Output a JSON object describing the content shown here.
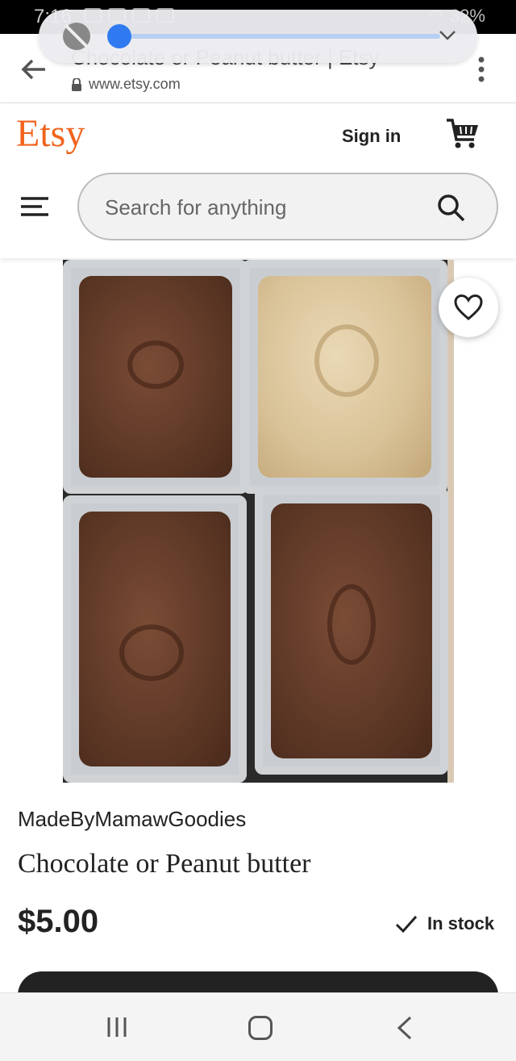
{
  "status_bar": {
    "time": "7:16",
    "battery": "32%"
  },
  "brightness_panel": {
    "level_fraction": 0.0
  },
  "browser": {
    "page_title": "Chocolate or Peanut butter | Etsy",
    "url": "www.etsy.com"
  },
  "header": {
    "logo": "Etsy",
    "sign_in_label": "Sign in",
    "search_placeholder": "Search for anything"
  },
  "product": {
    "shop_name": "MadeByMamawGoodies",
    "title": "Chocolate or Peanut butter",
    "price": "$5.00",
    "stock_status": "In stock"
  },
  "colors": {
    "brand": "#f1641e",
    "slider": "#2f7af0",
    "dark_button": "#222222"
  },
  "icons": [
    "mute-icon",
    "chevron-down-icon",
    "back-arrow-icon",
    "lock-icon",
    "more-vert-icon",
    "cart-icon",
    "menu-icon",
    "search-icon",
    "heart-icon",
    "check-icon",
    "recents-icon",
    "home-icon",
    "nav-back-icon"
  ]
}
